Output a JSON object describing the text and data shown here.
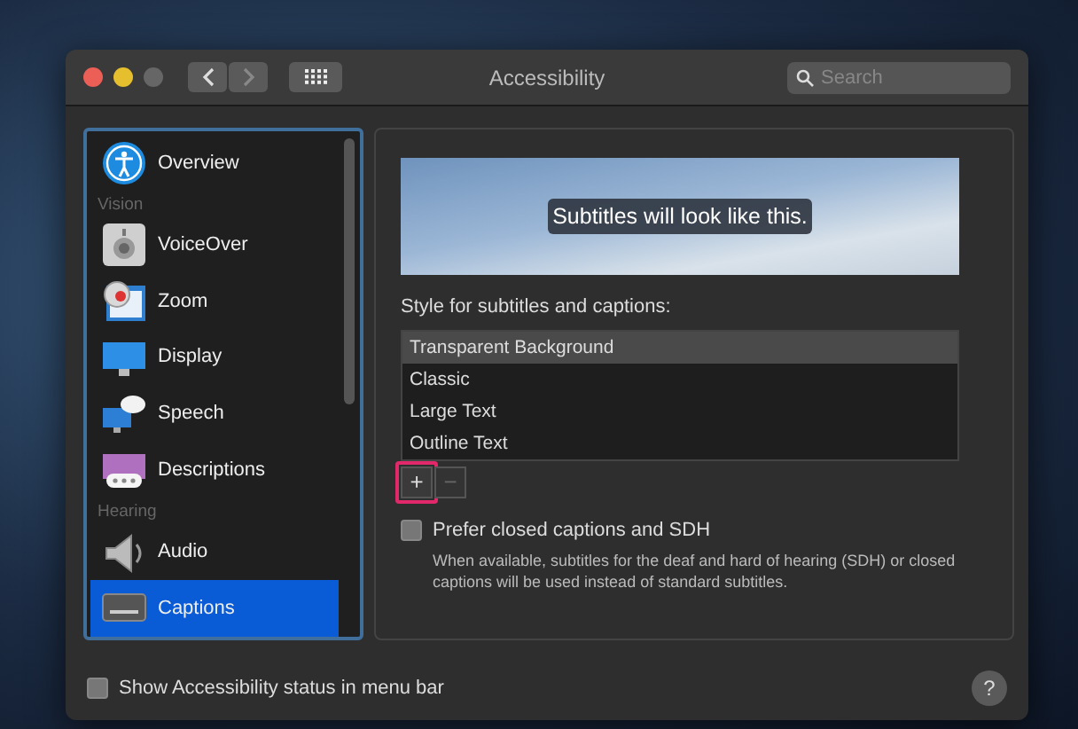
{
  "window": {
    "title": "Accessibility"
  },
  "search": {
    "placeholder": "Search"
  },
  "sidebar": {
    "items": [
      {
        "kind": "item",
        "label": "Overview",
        "selected": false
      },
      {
        "kind": "header",
        "label": "Vision"
      },
      {
        "kind": "item",
        "label": "VoiceOver",
        "selected": false
      },
      {
        "kind": "item",
        "label": "Zoom",
        "selected": false
      },
      {
        "kind": "item",
        "label": "Display",
        "selected": false
      },
      {
        "kind": "item",
        "label": "Speech",
        "selected": false
      },
      {
        "kind": "item",
        "label": "Descriptions",
        "selected": false
      },
      {
        "kind": "header",
        "label": "Hearing"
      },
      {
        "kind": "item",
        "label": "Audio",
        "selected": false
      },
      {
        "kind": "item",
        "label": "Captions",
        "selected": true
      }
    ]
  },
  "preview": {
    "caption": "Subtitles will look like this."
  },
  "styles": {
    "label": "Style for subtitles and captions:",
    "items": [
      {
        "label": "Transparent Background",
        "selected": true
      },
      {
        "label": "Classic",
        "selected": false
      },
      {
        "label": "Large Text",
        "selected": false
      },
      {
        "label": "Outline Text",
        "selected": false
      }
    ],
    "buttons": [
      {
        "symbol": "+",
        "disabled": false
      },
      {
        "symbol": "−",
        "disabled": true
      }
    ]
  },
  "sdh": {
    "label": "Prefer closed captions and SDH",
    "checked": false,
    "description": "When available, subtitles for the deaf and hard of hearing (SDH) or closed captions will be used instead of standard subtitles."
  },
  "status_option": {
    "label": "Show Accessibility status in menu bar",
    "checked": false
  },
  "help": {
    "symbol": "?"
  }
}
